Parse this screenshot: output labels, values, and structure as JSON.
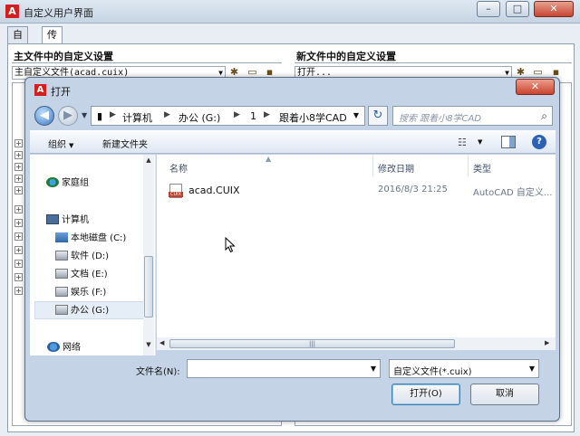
{
  "window": {
    "title": "自定义用户界面",
    "minimize": "–",
    "maximize": "□",
    "close": "✕"
  },
  "tabs": [
    "自定义",
    "传输"
  ],
  "left_panel": {
    "heading": "主文件中的自定义设置",
    "combo": "主自定义文件(acad.cuix)"
  },
  "right_panel": {
    "heading": "新文件中的自定义设置",
    "combo": "打开..."
  },
  "dialog": {
    "title": "打开",
    "close": "✕",
    "address": [
      "计算机",
      "办公 (G:)",
      "1",
      "跟着小8学CAD"
    ],
    "search_placeholder": "搜索 跟着小8学CAD",
    "toolbar": {
      "organize": "组织",
      "new_folder": "新建文件夹"
    },
    "nav": {
      "homegroup": "家庭组",
      "computer": "计算机",
      "drives": [
        "本地磁盘 (C:)",
        "软件 (D:)",
        "文档 (E:)",
        "娱乐 (F:)",
        "办公 (G:)"
      ],
      "selected_drive_index": 4,
      "network": "网络"
    },
    "columns": {
      "name": "名称",
      "date": "修改日期",
      "type": "类型"
    },
    "files": [
      {
        "name": "acad.CUIX",
        "date": "2016/8/3 21:25",
        "type": "AutoCAD 自定义..."
      }
    ],
    "filename_label": "文件名(N):",
    "filename_value": "",
    "filetype": "自定义文件(*.cuix)",
    "open_button": "打开(O)",
    "cancel_button": "取消"
  },
  "colors": {
    "accent": "#3c7fb1",
    "title_red": "#d02020",
    "nav_selected": "#e5edf6"
  }
}
